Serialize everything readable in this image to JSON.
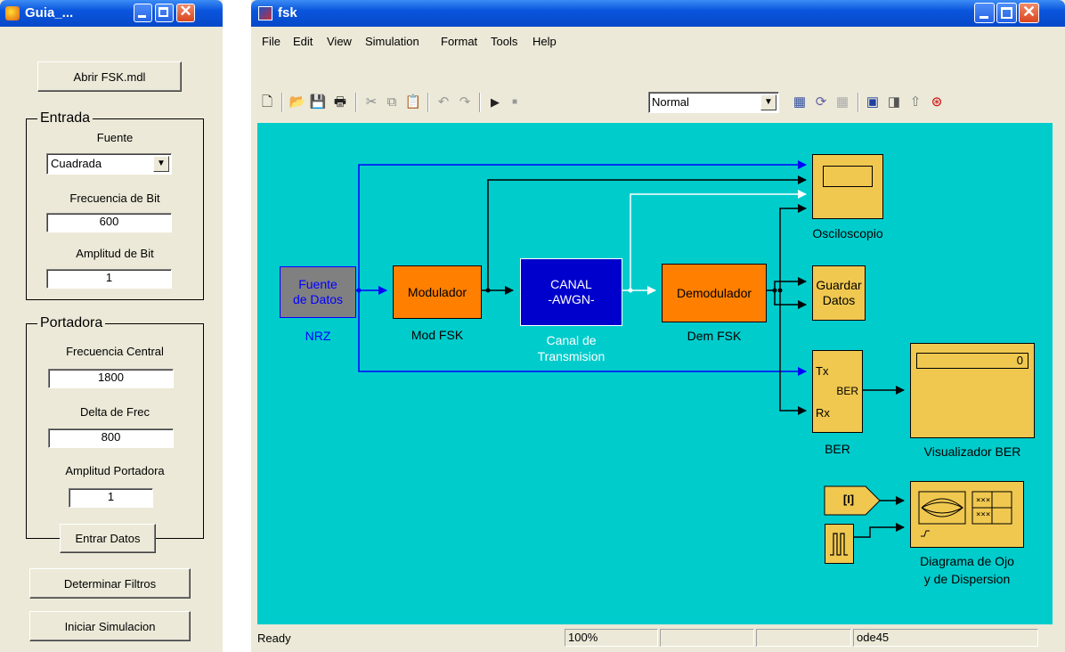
{
  "gui": {
    "title": "Guia_...",
    "open_button": "Abrir FSK.mdl",
    "entrada": {
      "title": "Entrada",
      "fuente_label": "Fuente",
      "fuente_value": "Cuadrada",
      "frec_bit_label": "Frecuencia de Bit",
      "frec_bit_value": "600",
      "amp_bit_label": "Amplitud de Bit",
      "amp_bit_value": "1"
    },
    "portadora": {
      "title": "Portadora",
      "frec_central_label": "Frecuencia Central",
      "frec_central_value": "1800",
      "delta_label": "Delta de Frec",
      "delta_value": "800",
      "amp_port_label": "Amplitud Portadora",
      "amp_port_value": "1"
    },
    "enter_button": "Entrar Datos",
    "filters_button": "Determinar Filtros",
    "start_button": "Iniciar Simulacion"
  },
  "model": {
    "title": "fsk",
    "menu": [
      "File",
      "Edit",
      "View",
      "Simulation",
      "Format",
      "Tools",
      "Help"
    ],
    "sim_mode": "Normal",
    "blocks": {
      "source": {
        "text": "Fuente de Datos",
        "line1": "Fuente",
        "line2": "de Datos",
        "label": "NRZ"
      },
      "modulator": {
        "text": "Modulador",
        "label": "Mod FSK"
      },
      "channel": {
        "line1": "CANAL",
        "line2": "-AWGN-",
        "label1": "Canal de",
        "label2": "Transmision"
      },
      "demodulator": {
        "text": "Demodulador",
        "label": "Dem FSK"
      },
      "scope": {
        "label": "Osciloscopio"
      },
      "save": {
        "line1": "Guardar",
        "line2": "Datos"
      },
      "ber": {
        "tx": "Tx",
        "ber": "BER",
        "rx": "Rx",
        "label": "BER"
      },
      "display": {
        "value": "0",
        "label": "Visualizador BER"
      },
      "from_tag": {
        "text": "[I]"
      },
      "eye": {
        "label1": "Diagrama de Ojo",
        "label2": "y de Dispersion"
      }
    },
    "status": {
      "text": "Ready",
      "zoom": "100%",
      "solver": "ode45"
    },
    "colors": {
      "canvas": "#00cccc",
      "orange_block": "#ff7f00",
      "channel_block": "#0000cc",
      "source_block": "#808080",
      "yellow_block": "#f0c850",
      "blue_line": "#0000ff",
      "black_line": "#000000",
      "white_line": "#ffffff"
    }
  }
}
